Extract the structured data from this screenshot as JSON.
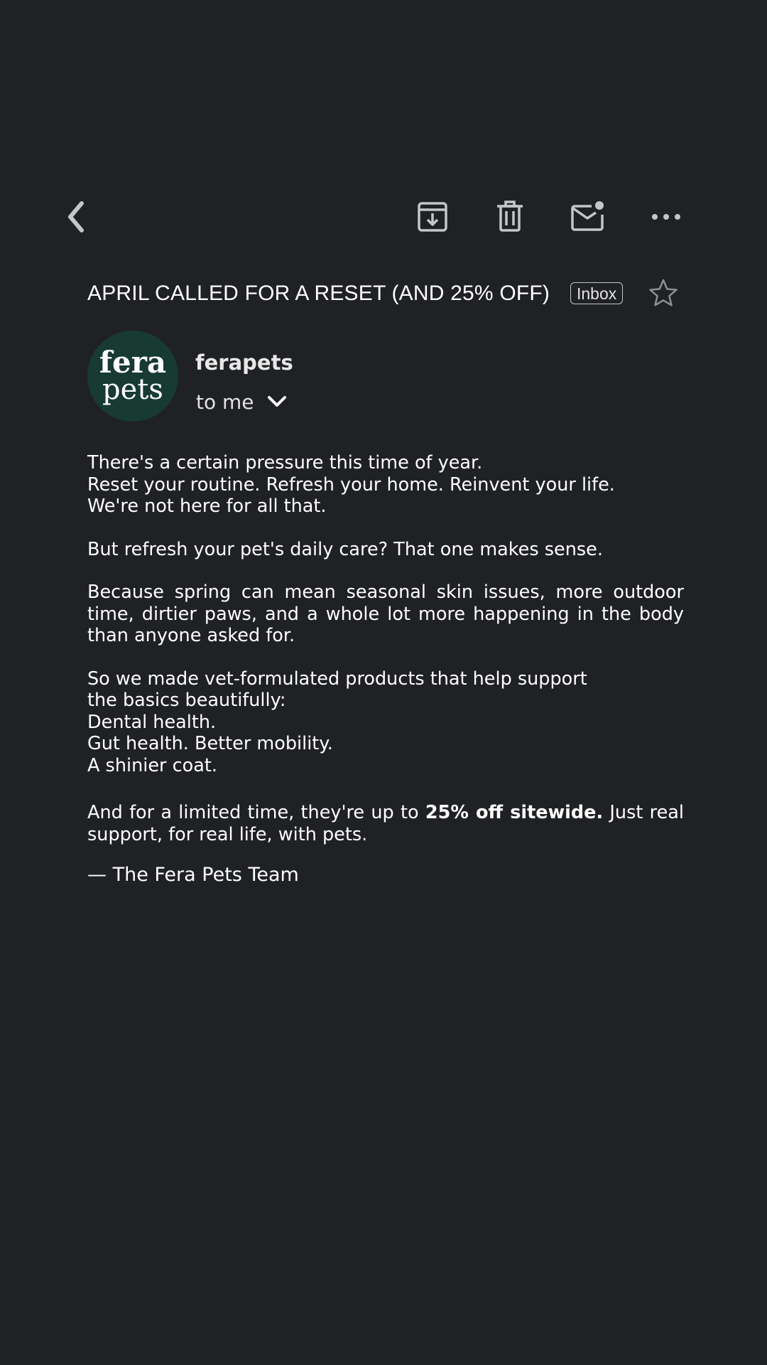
{
  "toolbar": {
    "back_icon": "chevron-left-icon",
    "archive_icon": "archive-icon",
    "delete_icon": "trash-icon",
    "mark_unread_icon": "mail-unread-icon",
    "more_icon": "more-horizontal-icon"
  },
  "email": {
    "subject": "APRIL CALLED FOR A RESET (AND 25% OFF)",
    "label": "Inbox",
    "starred": false,
    "sender": {
      "name": "ferapets",
      "avatar_text_top": "fera",
      "avatar_text_bottom": "pets",
      "avatar_color": "#173a32"
    },
    "recipient": "to me",
    "body": {
      "p1": [
        "There's a certain pressure this time of year.",
        "Reset your routine. Refresh your home. Reinvent your life.",
        "We're not here for all that."
      ],
      "p2": "But refresh your pet's daily care? That one makes sense.",
      "p3": "Because spring can mean seasonal skin issues, more outdoor time, dirtier paws, and a whole lot more happening in the body than anyone asked for.",
      "p4": [
        "So we made vet-formulated products that help support",
        "the basics beautifully:",
        "Dental health.",
        "Gut health. Better mobility.",
        "A shinier coat."
      ],
      "p5_before": "And for a limited time, they're up to ",
      "p5_bold": "25% off sitewide.",
      "p5_after": " Just real support, for real life, with pets.",
      "signoff": "— The Fera Pets Team"
    }
  },
  "colors": {
    "background": "#202124",
    "text": "#ffffff",
    "icon": "#c4c7c5"
  }
}
